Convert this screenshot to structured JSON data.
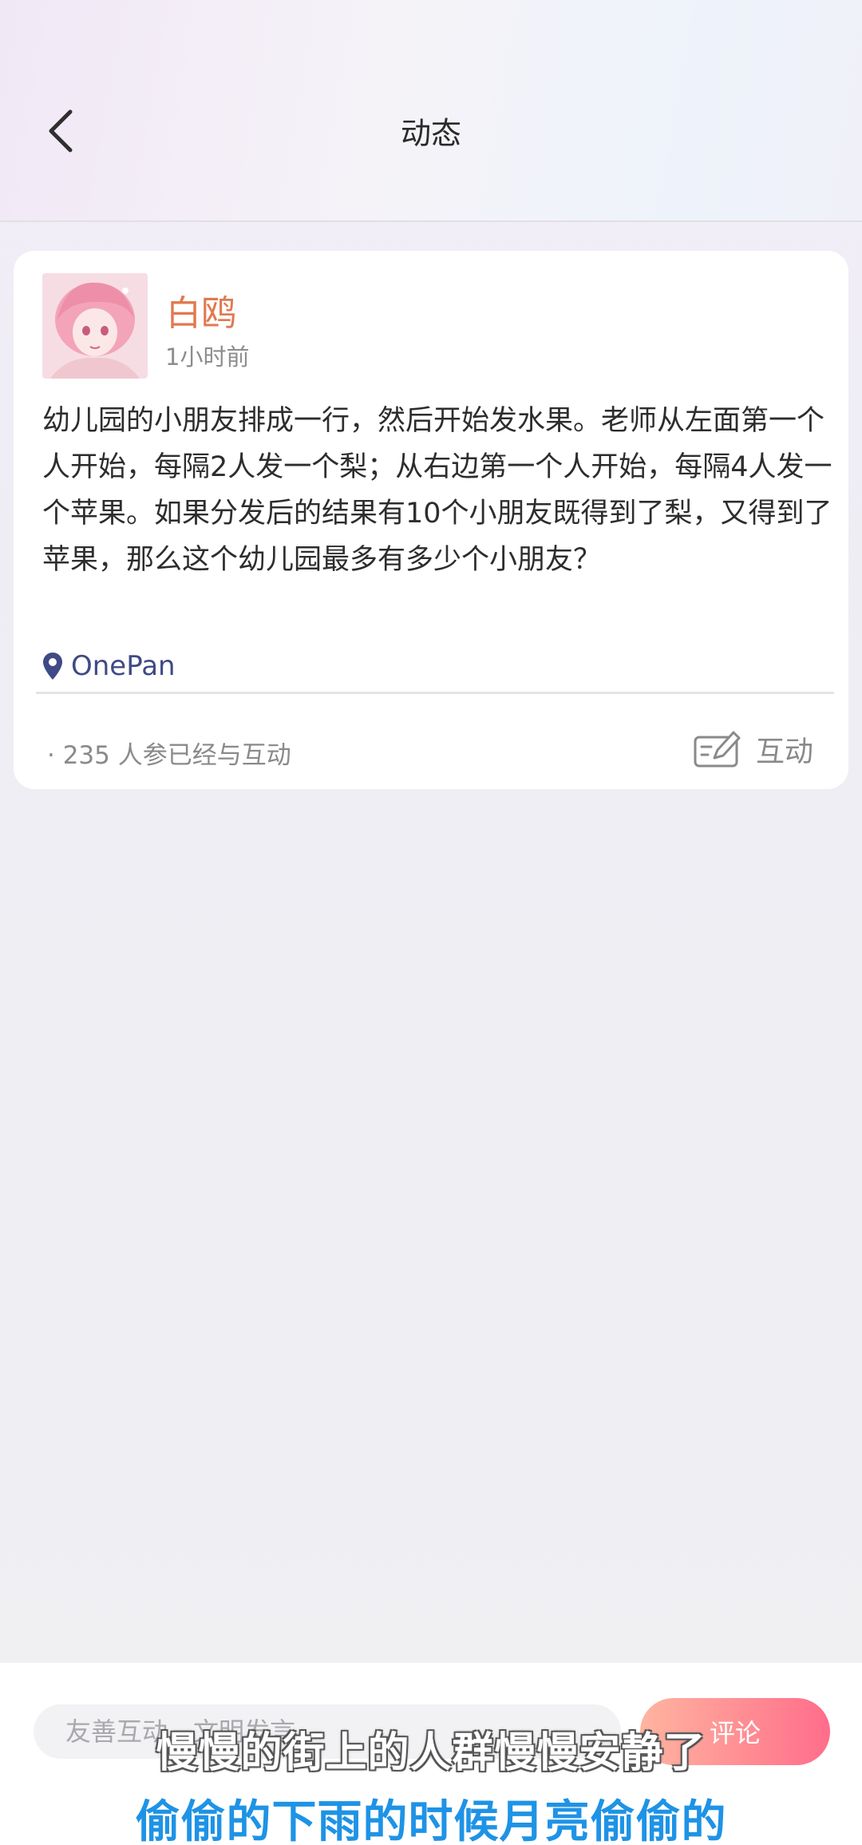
{
  "header": {
    "title": "动态"
  },
  "post": {
    "username": "白鸥",
    "time": "1小时前",
    "body": "幼儿园的小朋友排成一行，然后开始发水果。老师从左面第一个人开始，每隔2人发一个梨；从右边第一个人开始，每隔4人发一个苹果。如果分发后的结果有10个小朋友既得到了梨，又得到了苹果，那么这个幼儿园最多有多少个小朋友？",
    "location": "OnePan",
    "stats": "· 235  人参已经与互动",
    "interact_label": "互动",
    "username_color": "#e0794f",
    "location_icon_color": "#3f4a86"
  },
  "comment_bar": {
    "placeholder": "友善互动，文明发言",
    "submit_label": "评论"
  },
  "subtitles": {
    "line1": "慢慢的街上的人群慢慢安静了",
    "line2": "偷偷的下雨的时候月亮偷偷的"
  }
}
